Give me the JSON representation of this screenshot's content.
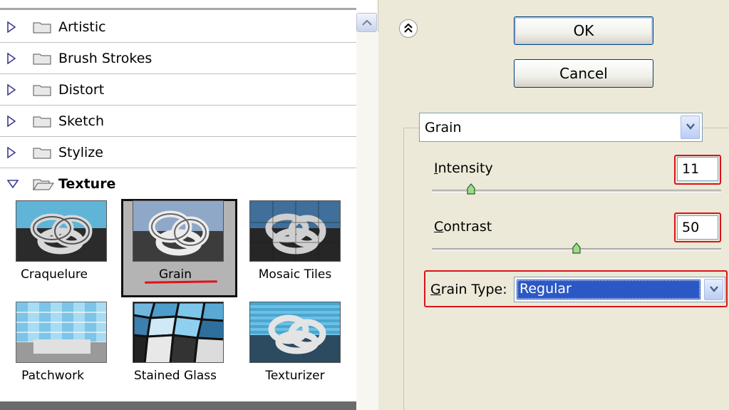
{
  "filter_gallery": {
    "categories": [
      {
        "label": "Artistic",
        "expanded": false
      },
      {
        "label": "Brush Strokes",
        "expanded": false
      },
      {
        "label": "Distort",
        "expanded": false
      },
      {
        "label": "Sketch",
        "expanded": false
      },
      {
        "label": "Stylize",
        "expanded": false
      },
      {
        "label": "Texture",
        "expanded": true
      }
    ],
    "texture_filters": [
      {
        "label": "Craquelure",
        "selected": false
      },
      {
        "label": "Grain",
        "selected": true
      },
      {
        "label": "Mosaic Tiles",
        "selected": false
      },
      {
        "label": "Patchwork",
        "selected": false
      },
      {
        "label": "Stained Glass",
        "selected": false
      },
      {
        "label": "Texturizer",
        "selected": false
      }
    ]
  },
  "dialog": {
    "ok_label": "OK",
    "cancel_label": "Cancel",
    "filter_select_value": "Grain",
    "params": {
      "intensity": {
        "label": "Intensity",
        "value": "11",
        "slider_fraction": 0.11
      },
      "contrast": {
        "label": "Contrast",
        "value": "50",
        "slider_fraction": 0.5
      },
      "grain_type": {
        "label": "Grain Type:",
        "value": "Regular"
      }
    }
  },
  "colors": {
    "highlight_red": "#d9141c",
    "selection_blue": "#2b58c4",
    "dialog_bg": "#ece9d8"
  }
}
